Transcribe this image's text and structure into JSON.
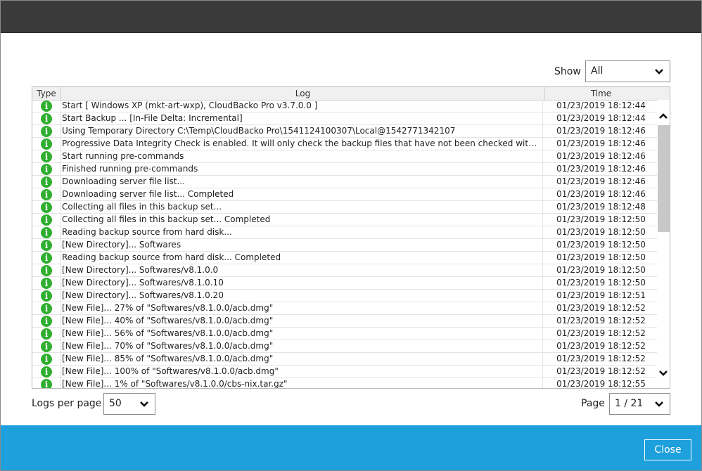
{
  "filter": {
    "show_label": "Show",
    "show_value": "All"
  },
  "table": {
    "columns": {
      "type": "Type",
      "log": "Log",
      "time": "Time"
    },
    "rows": [
      {
        "log": "Start [ Windows XP (mkt-art-wxp), CloudBacko Pro v3.7.0.0 ]",
        "time": "01/23/2019 18:12:44"
      },
      {
        "log": "Start Backup ... [In-File Delta: Incremental]",
        "time": "01/23/2019 18:12:44"
      },
      {
        "log": "Using Temporary Directory C:\\Temp\\CloudBacko Pro\\1541124100307\\Local@1542771342107",
        "time": "01/23/2019 18:12:46"
      },
      {
        "log": "Progressive Data Integrity Check is enabled. It will only check the backup files that have not been checked within the specifi...",
        "time": "01/23/2019 18:12:46"
      },
      {
        "log": "Start running pre-commands",
        "time": "01/23/2019 18:12:46"
      },
      {
        "log": "Finished running pre-commands",
        "time": "01/23/2019 18:12:46"
      },
      {
        "log": "Downloading server file list...",
        "time": "01/23/2019 18:12:46"
      },
      {
        "log": "Downloading server file list... Completed",
        "time": "01/23/2019 18:12:46"
      },
      {
        "log": "Collecting all files in this backup set...",
        "time": "01/23/2019 18:12:48"
      },
      {
        "log": "Collecting all files in this backup set... Completed",
        "time": "01/23/2019 18:12:50"
      },
      {
        "log": "Reading backup source from hard disk...",
        "time": "01/23/2019 18:12:50"
      },
      {
        "log": "[New Directory]... Softwares",
        "time": "01/23/2019 18:12:50"
      },
      {
        "log": "Reading backup source from hard disk... Completed",
        "time": "01/23/2019 18:12:50"
      },
      {
        "log": "[New Directory]... Softwares/v8.1.0.0",
        "time": "01/23/2019 18:12:50"
      },
      {
        "log": "[New Directory]... Softwares/v8.1.0.10",
        "time": "01/23/2019 18:12:50"
      },
      {
        "log": "[New Directory]... Softwares/v8.1.0.20",
        "time": "01/23/2019 18:12:51"
      },
      {
        "log": "[New File]... 27% of \"Softwares/v8.1.0.0/acb.dmg\"",
        "time": "01/23/2019 18:12:52"
      },
      {
        "log": "[New File]... 40% of \"Softwares/v8.1.0.0/acb.dmg\"",
        "time": "01/23/2019 18:12:52"
      },
      {
        "log": "[New File]... 56% of \"Softwares/v8.1.0.0/acb.dmg\"",
        "time": "01/23/2019 18:12:52"
      },
      {
        "log": "[New File]... 70% of \"Softwares/v8.1.0.0/acb.dmg\"",
        "time": "01/23/2019 18:12:52"
      },
      {
        "log": "[New File]... 85% of \"Softwares/v8.1.0.0/acb.dmg\"",
        "time": "01/23/2019 18:12:52"
      },
      {
        "log": "[New File]... 100% of \"Softwares/v8.1.0.0/acb.dmg\"",
        "time": "01/23/2019 18:12:52"
      },
      {
        "log": "[New File]... 1% of \"Softwares/v8.1.0.0/cbs-nix.tar.gz\"",
        "time": "01/23/2019 18:12:55"
      }
    ],
    "row_icon": "info-icon"
  },
  "pagination": {
    "logs_per_page_label": "Logs per page",
    "logs_per_page_value": "50",
    "page_label": "Page",
    "page_value": "1 / 21"
  },
  "footer": {
    "close_label": "Close"
  },
  "colors": {
    "titlebar": "#3a3a3a",
    "footer": "#1ea0dc",
    "info_icon": "#2fae2f"
  }
}
